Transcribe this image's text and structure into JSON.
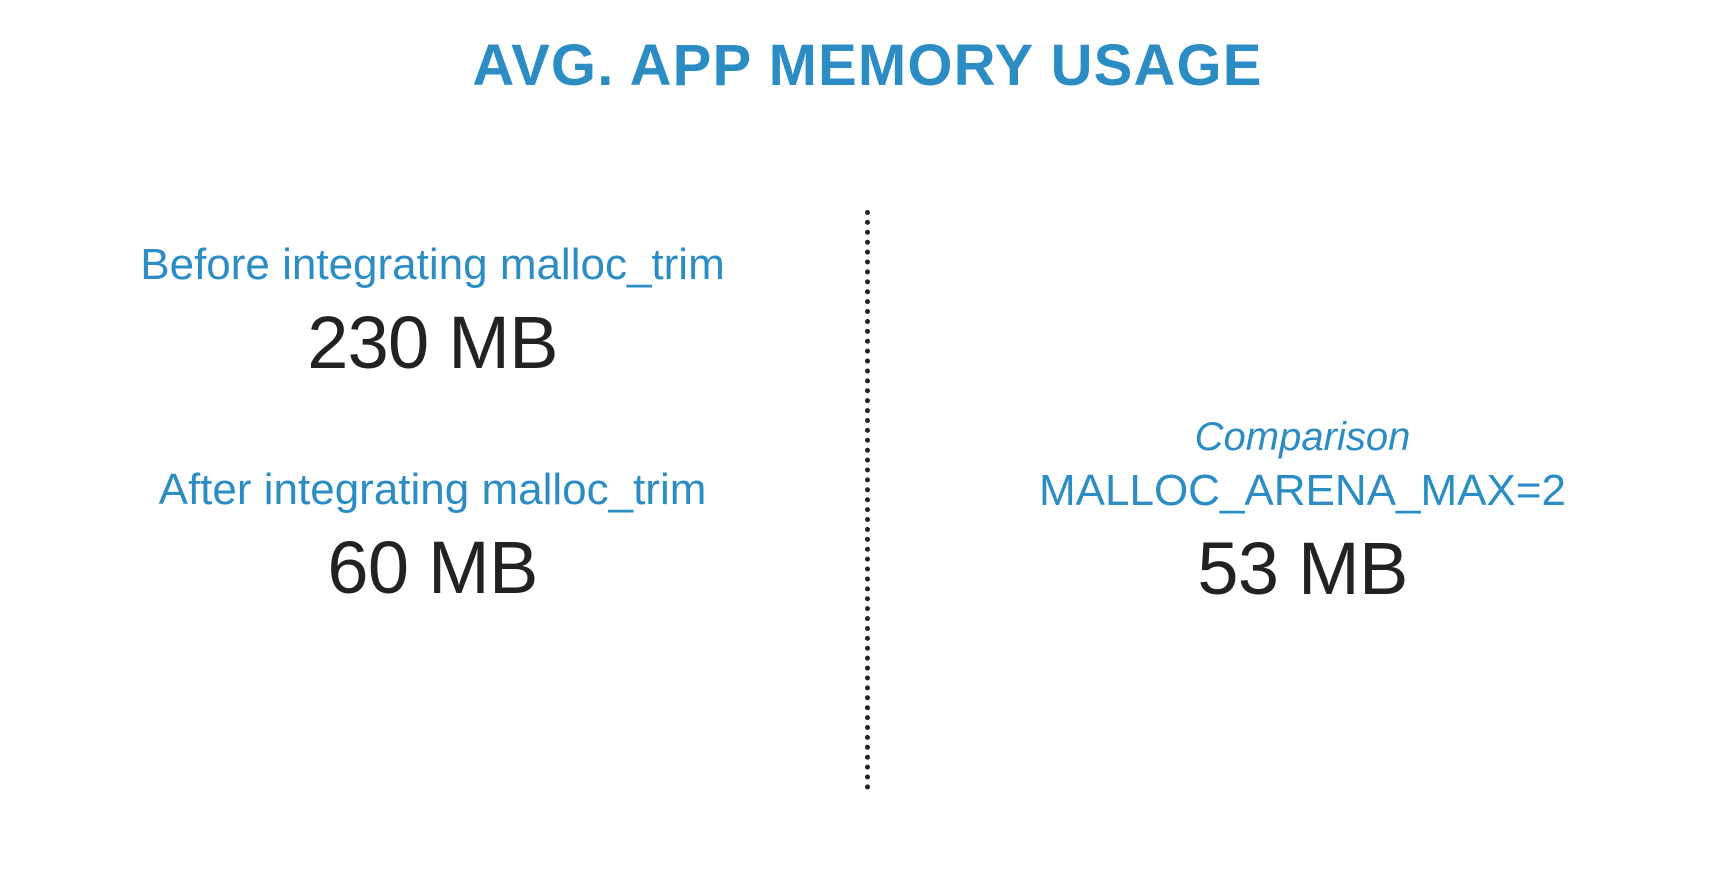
{
  "title": "AVG. APP MEMORY USAGE",
  "left": {
    "before": {
      "label": "Before integrating malloc_trim",
      "value": "230 MB"
    },
    "after": {
      "label": "After integrating malloc_trim",
      "value": "60 MB"
    }
  },
  "right": {
    "comparison_label": "Comparison",
    "comparison_sublabel": "MALLOC_ARENA_MAX=2",
    "value": "53 MB"
  },
  "chart_data": {
    "type": "table",
    "title": "Avg. App Memory Usage",
    "rows": [
      {
        "condition": "Before integrating malloc_trim",
        "memory_mb": 230
      },
      {
        "condition": "After integrating malloc_trim",
        "memory_mb": 60
      },
      {
        "condition": "MALLOC_ARENA_MAX=2 (comparison)",
        "memory_mb": 53
      }
    ]
  }
}
